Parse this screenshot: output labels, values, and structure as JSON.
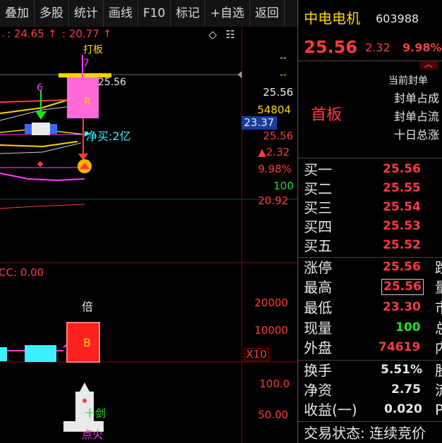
{
  "toolbar": {
    "items": [
      "叠加",
      "多股",
      "统计",
      "画线",
      "F10",
      "标记",
      "+自选",
      "返回"
    ]
  },
  "chart": {
    "top_info_a": ": 24.65",
    "top_info_a_arrow": "↑",
    "top_info_b": ": 20.77",
    "top_info_b_arrow": "↑",
    "diamond_icon": "◇",
    "grid_icon": "☷",
    "partial_label": "打板",
    "num_7": "7",
    "num_6": "6",
    "price_mark": "25.56",
    "letter_r": "R",
    "buy_label": "净买:2亿",
    "axis_dash1": "--",
    "axis_dash2": "--",
    "axis_price": "25.56",
    "axis_vol": "54804",
    "axis_highlight": "23.37",
    "axis_price2": "25.56",
    "axis_change": "▲2.32",
    "axis_pct": "9.98%",
    "axis_100": "100",
    "axis_low": "20.92",
    "indicator_label": "CC: 0.00",
    "bei_label": "倍",
    "letter_b": "B",
    "vol_20000": "20000",
    "vol_10000": "10000",
    "vol_x10": "X10",
    "lower_100": "100.0",
    "lower_50": "50.00",
    "shijian": "十剑",
    "dianhuo": "点火"
  },
  "panel": {
    "stock_name": "中电电机",
    "stock_code": "603988",
    "price": "25.56",
    "change": "2.32",
    "pct": "9.98%",
    "status_tag": "首板",
    "seal_lines": [
      "当前封单",
      "封单占成",
      "封单占流",
      "十日总涨"
    ],
    "bids": [
      {
        "label": "买一",
        "price": "25.56"
      },
      {
        "label": "买二",
        "price": "25.55"
      },
      {
        "label": "买三",
        "price": "25.54"
      },
      {
        "label": "买四",
        "price": "25.53"
      },
      {
        "label": "买五",
        "price": "25.52"
      }
    ],
    "stats": [
      {
        "label": "涨停",
        "value": "25.56",
        "cut": "跌"
      },
      {
        "label": "最高",
        "value": "25.56",
        "cut": "量"
      },
      {
        "label": "最低",
        "value": "23.30",
        "cut": "市"
      },
      {
        "label": "现量",
        "value": "100",
        "cut": "总"
      },
      {
        "label": "外盘",
        "value": "74619",
        "cut": "内"
      }
    ],
    "fin": [
      {
        "label": "换手",
        "value": "5.51%",
        "cut": "股"
      },
      {
        "label": "净资",
        "value": "2.75",
        "cut": "流"
      },
      {
        "label": "收益(一)",
        "value": "0.020",
        "cut": "P"
      }
    ],
    "trade_status": "交易状态: 连续竞价"
  },
  "colors": {
    "up": "#ff3b3b",
    "down": "#20e020",
    "accent_yellow": "#ffd400",
    "magenta": "#ff3cff",
    "cyan": "#3cf0ff"
  }
}
